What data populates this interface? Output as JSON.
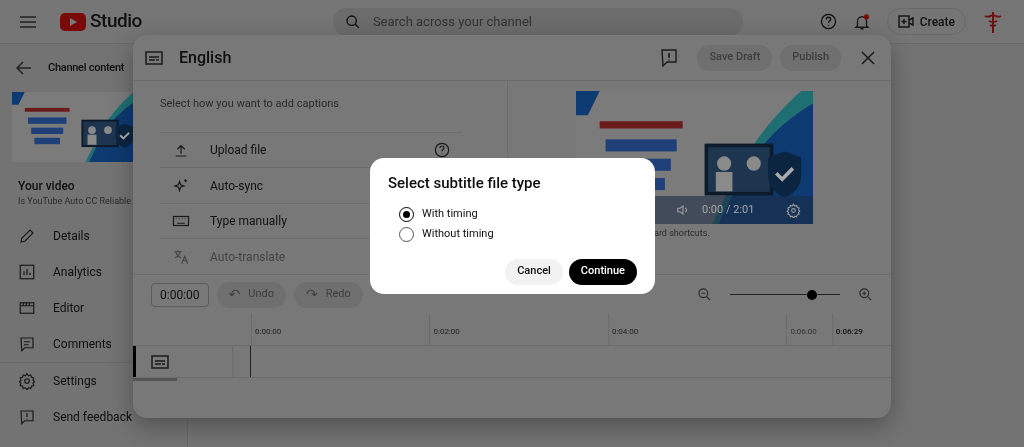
{
  "header": {
    "logo": "Studio",
    "search": {
      "placeholder": "Search across your channel"
    },
    "create_button": "Create",
    "notifications": {
      "unread": true
    }
  },
  "sidebar": {
    "back_label": "Channel content",
    "video_heading": "Your video",
    "video_title": "Is YouTube Auto CC Reliable",
    "items": [
      {
        "label": "Details"
      },
      {
        "label": "Analytics"
      },
      {
        "label": "Editor"
      },
      {
        "label": "Comments"
      }
    ],
    "footer": [
      {
        "label": "Settings"
      },
      {
        "label": "Send feedback"
      }
    ]
  },
  "editor": {
    "title": "English",
    "save_draft": "Save Draft",
    "publish": "Publish",
    "prompt": "Select how you want to add captions",
    "options": [
      {
        "label": "Upload file",
        "disabled": false
      },
      {
        "label": "Auto-sync",
        "disabled": false
      },
      {
        "label": "Type manually",
        "disabled": false
      },
      {
        "label": "Auto-translate",
        "disabled": true
      }
    ],
    "player": {
      "time": "0:00 / 2:01"
    },
    "hint": "ard shortcuts.",
    "time_field": "0:00:00",
    "undo": {
      "label": "Undo",
      "glyph": "↶"
    },
    "redo": {
      "label": "Redo",
      "glyph": "↷"
    },
    "zoom": {
      "level": 0.75
    },
    "ticks": [
      {
        "label": "0:00:00",
        "kind": "start"
      },
      {
        "label": "0:02:00",
        "kind": "tick"
      },
      {
        "label": "0:04:00",
        "kind": "tick"
      },
      {
        "label": "0:06:00",
        "kind": "faint"
      },
      {
        "label": "0:06:29",
        "kind": "end"
      }
    ]
  },
  "dialog": {
    "title": "Select subtitle file type",
    "options": [
      {
        "label": "With timing",
        "selected": true
      },
      {
        "label": "Without timing",
        "selected": false
      }
    ],
    "cancel": "Cancel",
    "continue": "Continue"
  }
}
